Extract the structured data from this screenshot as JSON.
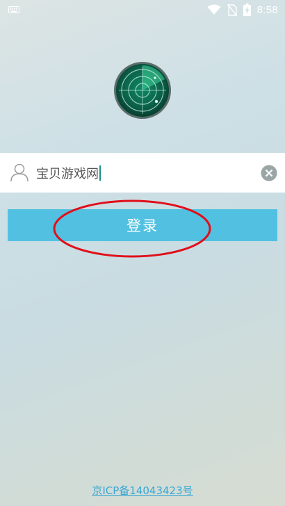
{
  "status_bar": {
    "time": "8:58",
    "icons": [
      "keyboard-icon",
      "wifi-icon",
      "no-sim-icon",
      "battery-charging-icon"
    ]
  },
  "logo": {
    "icon": "radar-icon"
  },
  "login_form": {
    "username_value": "宝贝游戏网",
    "user_icon": "user-icon",
    "clear_icon": "clear-icon",
    "login_label": "登录"
  },
  "footer": {
    "icp_text": "京ICP备14043423号"
  },
  "colors": {
    "button": "#52c1e1",
    "link": "#3aa7d4",
    "annotation": "#e0101a",
    "radar": "#0e6e55"
  }
}
